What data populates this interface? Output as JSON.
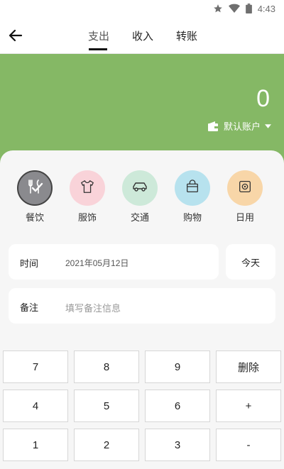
{
  "status": {
    "time": "4:43"
  },
  "tabs": [
    {
      "label": "支出"
    },
    {
      "label": "收入"
    },
    {
      "label": "转账"
    }
  ],
  "banner": {
    "amount": "0",
    "account": "默认账户",
    "color": "#85b865"
  },
  "categories": [
    {
      "label": "餐饮",
      "icon": "fork-knife-icon",
      "color": "#8a8a8e",
      "selected": true
    },
    {
      "label": "服饰",
      "icon": "shirt-icon",
      "color": "#f9d3d9"
    },
    {
      "label": "交通",
      "icon": "car-icon",
      "color": "#cde9d9"
    },
    {
      "label": "购物",
      "icon": "shopping-bag-icon",
      "color": "#b7e2ee"
    },
    {
      "label": "日用",
      "icon": "toilet-paper-icon",
      "color": "#f8d6a8"
    }
  ],
  "time_field": {
    "label": "时间",
    "value": "2021年05月12日",
    "today_label": "今天"
  },
  "note_field": {
    "label": "备注",
    "placeholder": "填写备注信息"
  },
  "keypad": {
    "rows": [
      [
        "7",
        "8",
        "9",
        "删除"
      ],
      [
        "4",
        "5",
        "6",
        "+"
      ],
      [
        "1",
        "2",
        "3",
        "-"
      ]
    ]
  }
}
